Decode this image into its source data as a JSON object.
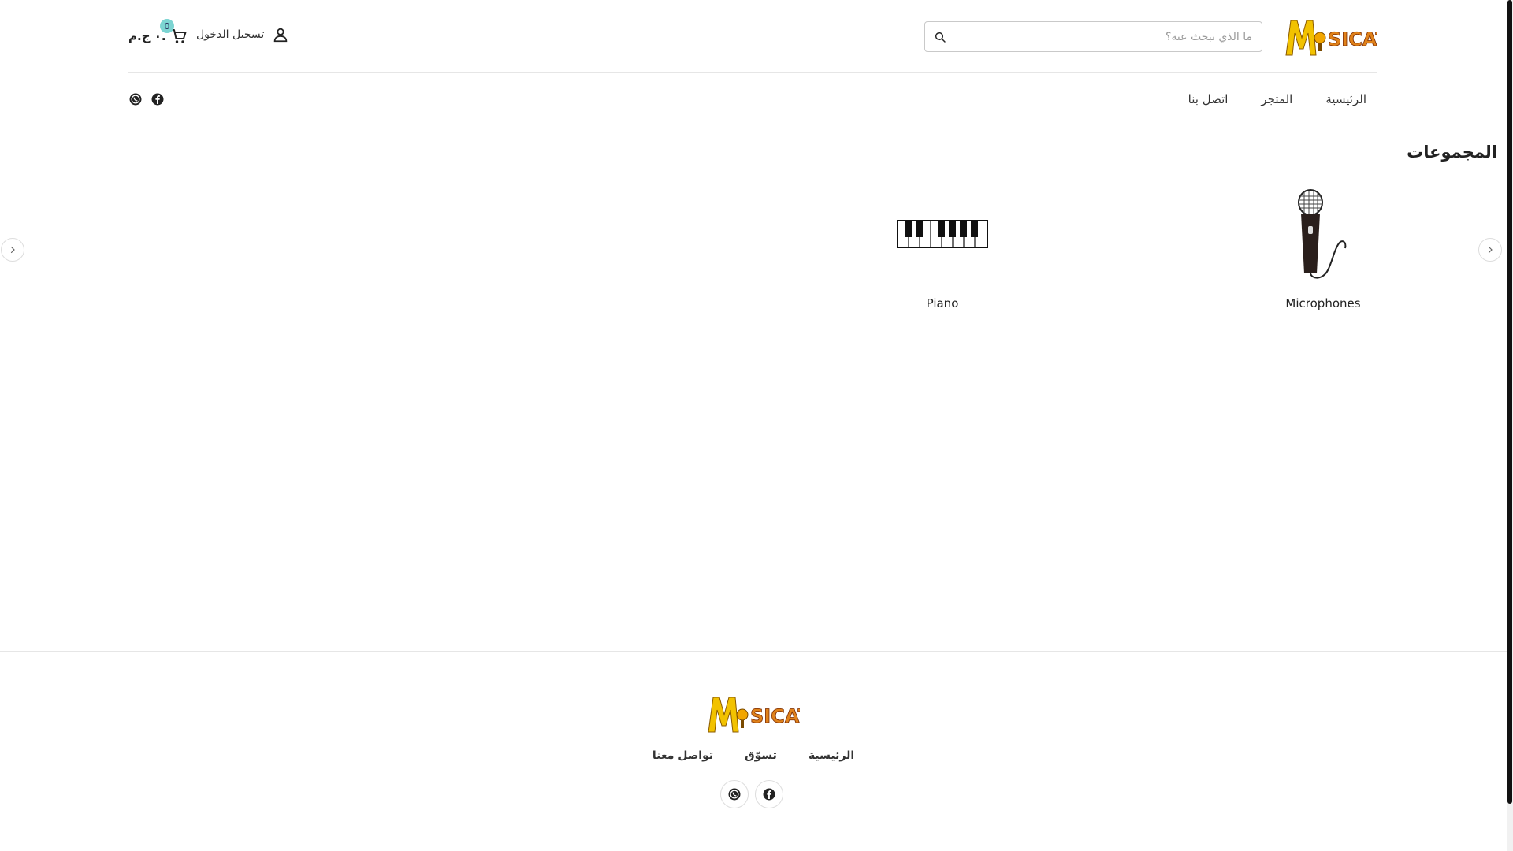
{
  "brand": {
    "logo_text": "MUSICAT",
    "accent_yellow": "#f2c200",
    "accent_red": "#d2421a"
  },
  "header": {
    "search": {
      "placeholder": "ما الذي تبحث عنه؟"
    },
    "account_label": "تسجيل الدخول",
    "cart": {
      "count": "0",
      "price": "٠ ج.م."
    },
    "nav": [
      {
        "label": "الرئيسية"
      },
      {
        "label": "المتجر"
      },
      {
        "label": "اتصل بنا"
      }
    ]
  },
  "collections": {
    "title": "المجموعات",
    "items": [
      {
        "name": "Microphones",
        "icon": "microphone-icon"
      },
      {
        "name": "Piano",
        "icon": "piano-keys-icon"
      }
    ]
  },
  "footer": {
    "links": [
      {
        "label": "الرئيسية"
      },
      {
        "label": "تسوّق"
      },
      {
        "label": "تواصل معنا"
      }
    ]
  },
  "colors": {
    "cart_badge": "#7cd4d2",
    "scrollbar": "#111111"
  }
}
